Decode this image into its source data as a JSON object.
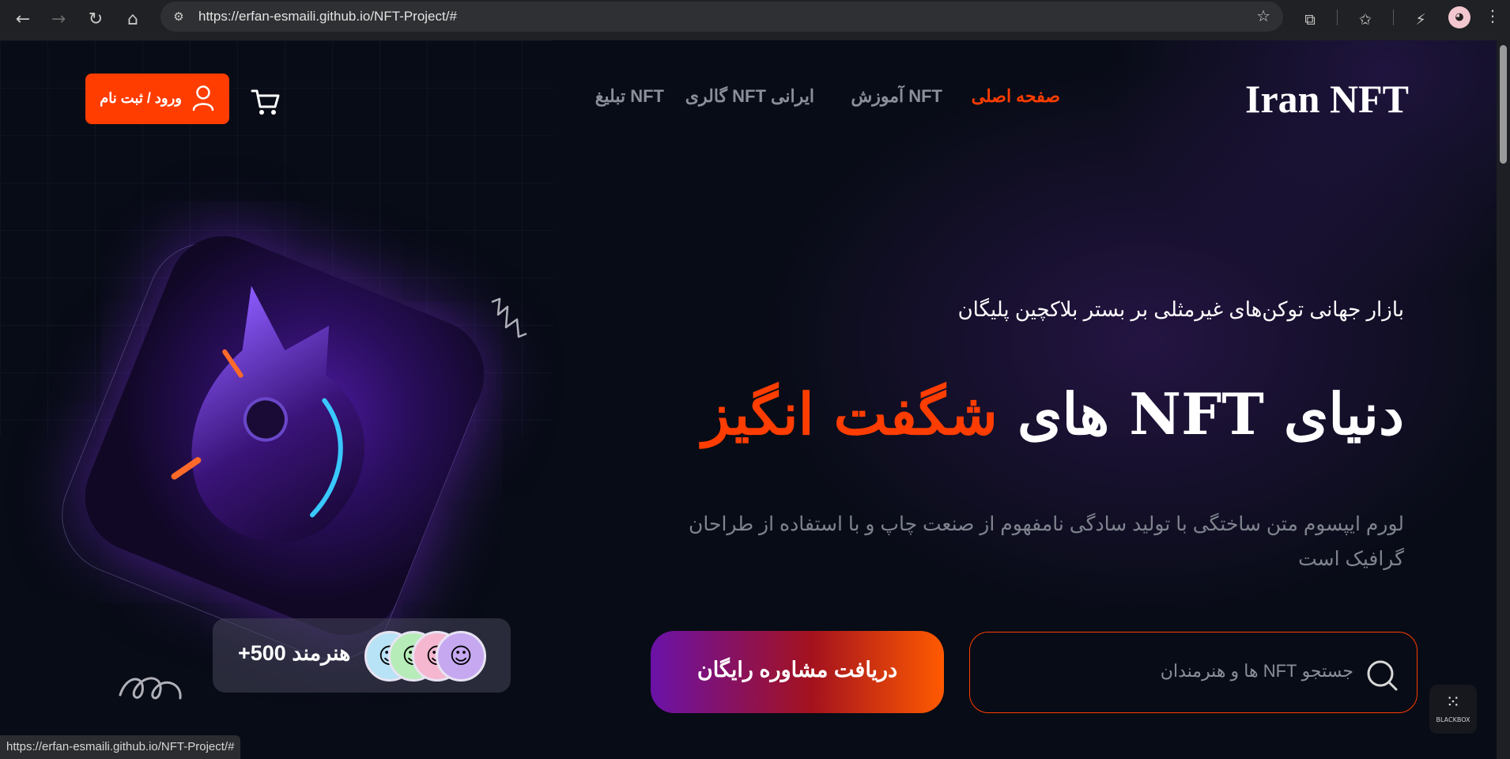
{
  "browser": {
    "url": "https://erfan-esmaili.github.io/NFT-Project/#",
    "status_url": "https://erfan-esmaili.github.io/NFT-Project/#"
  },
  "header": {
    "brand": "Iran NFT",
    "nav": [
      {
        "label": "صفحه اصلی",
        "active": true
      },
      {
        "label": "آموزش NFT",
        "active": false
      },
      {
        "label": "گالری NFT ایرانی",
        "active": false
      },
      {
        "label": "تبلیغ NFT",
        "active": false
      }
    ],
    "login_label": "ورود / ثبت نام"
  },
  "hero": {
    "kicker": "بازار جهانی توکن‌های غیرمثلی بر بستر بلاکچین پلیگان",
    "headline_main": "دنیای NFT های ",
    "headline_accent": "شگفت انگیز",
    "description": "لورم ایپسوم متن ساختگی با تولید سادگی نامفهوم از صنعت چاپ و با استفاده از طراحان گرافیک است",
    "search_placeholder": "جستجو NFT ها و هنرمندان",
    "cta_label": "دریافت مشاوره رایگان",
    "artists_count": "+500 هنرمند"
  },
  "extension": {
    "label": "BLACKBOX"
  },
  "colors": {
    "accent": "#ff3d00",
    "background": "#080c16",
    "muted_text": "#7e838e"
  }
}
